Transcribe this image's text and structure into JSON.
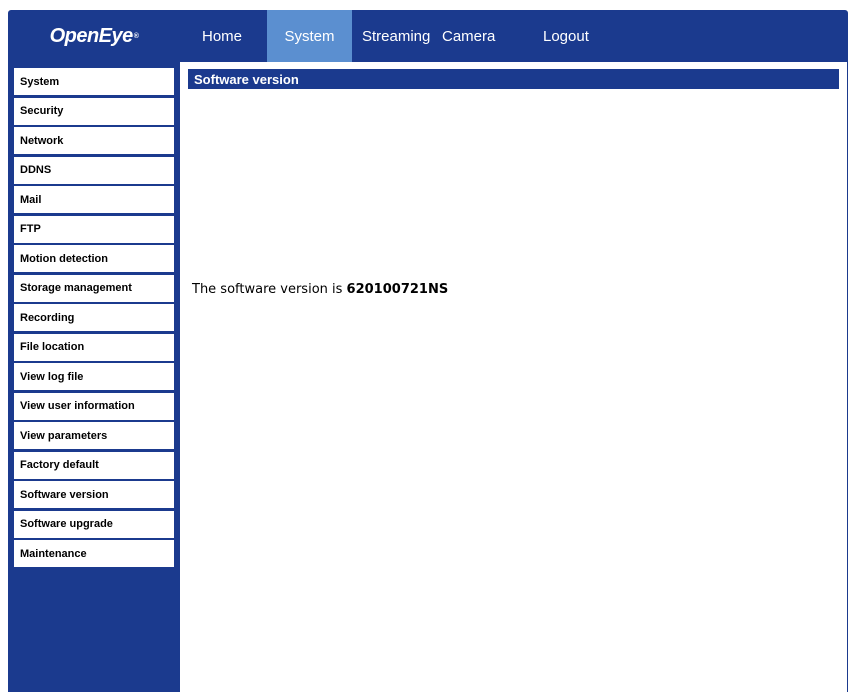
{
  "logo": {
    "text": "OpenEye",
    "mark": "®"
  },
  "nav": {
    "items": [
      "Home",
      "System",
      "Streaming",
      "Camera",
      "Logout"
    ],
    "active": "System"
  },
  "sidebar": {
    "items": [
      "System",
      "Security",
      "Network",
      "DDNS",
      "Mail",
      "FTP",
      "Motion detection",
      "Storage management",
      "Recording",
      "File location",
      "View log file",
      "View user information",
      "View parameters",
      "Factory default",
      "Software version",
      "Software upgrade",
      "Maintenance"
    ]
  },
  "main": {
    "title": "Software version",
    "version_label": "The software version is ",
    "version_value": "620100721NS"
  },
  "colors": {
    "brand_blue": "#1b3a8e",
    "active_tab": "#5b8fd0"
  }
}
